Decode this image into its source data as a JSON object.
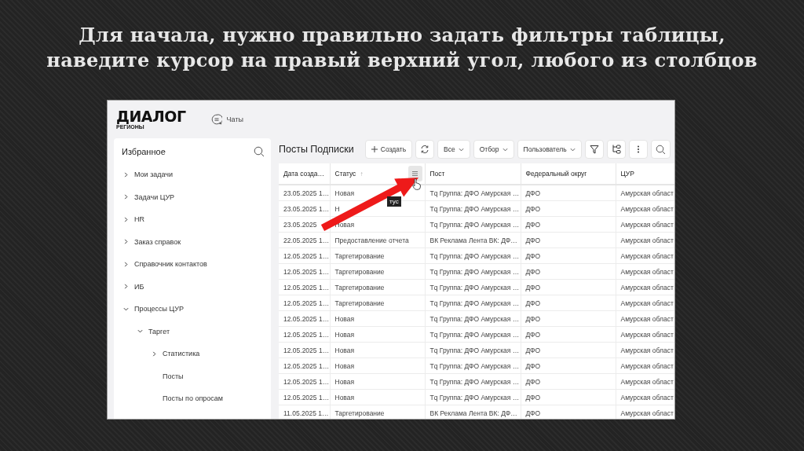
{
  "slide_title": [
    "Для начала, нужно правильно задать фильтры таблицы,",
    "наведите курсор на правый верхний угол, любого из столбцов"
  ],
  "app": {
    "logo": "ДИАЛОГ",
    "logo_sub": "РЕГИОНЫ",
    "top_link": "Чаты",
    "sidebar": {
      "title": "Избранное",
      "items": [
        {
          "label": "Мои задачи",
          "expanded": false
        },
        {
          "label": "Задачи ЦУР",
          "expanded": false
        },
        {
          "label": "HR",
          "expanded": false
        },
        {
          "label": "Заказ справок",
          "expanded": false
        },
        {
          "label": "Справочник контактов",
          "expanded": false
        },
        {
          "label": "ИБ",
          "expanded": false
        },
        {
          "label": "Процессы ЦУР",
          "expanded": true,
          "children": [
            {
              "label": "Таргет",
              "expanded": true,
              "children": [
                {
                  "label": "Статистика",
                  "expanded": false
                },
                {
                  "label": "Посты"
                },
                {
                  "label": "Посты по опросам"
                }
              ]
            }
          ]
        }
      ]
    },
    "page_title": "Посты Подписки",
    "toolbar": [
      {
        "kind": "create",
        "label": "Создать"
      },
      {
        "kind": "refresh"
      },
      {
        "kind": "dropdown",
        "label": "Все"
      },
      {
        "kind": "dropdown",
        "label": "Отбор"
      },
      {
        "kind": "dropdown",
        "label": "Пользователь"
      },
      {
        "kind": "filter"
      },
      {
        "kind": "tree"
      },
      {
        "kind": "more"
      },
      {
        "kind": "search"
      }
    ],
    "table": {
      "columns": [
        {
          "label": "Дата созда…"
        },
        {
          "label": "Статус",
          "sort_mark": "↑",
          "menu": true
        },
        {
          "label": "Пост"
        },
        {
          "label": "Федеральный округ"
        },
        {
          "label": "ЦУР"
        }
      ],
      "rows": [
        [
          "23.05.2025 1…",
          "Новая",
          "Tq Группа: ДФО Амурская …",
          "ДФО",
          "Амурская област"
        ],
        [
          "23.05.2025 1…",
          "Н",
          "Tq Группа: ДФО Амурская …",
          "ДФО",
          "Амурская област"
        ],
        [
          "23.05.2025",
          "Новая",
          "Tq Группа: ДФО Амурская …",
          "ДФО",
          "Амурская област"
        ],
        [
          "22.05.2025 1…",
          "Предоставление отчета",
          "ВК Реклама Лента ВК: ДФ…",
          "ДФО",
          "Амурская област"
        ],
        [
          "12.05.2025 1…",
          "Таргетирование",
          "Tq Группа: ДФО Амурская …",
          "ДФО",
          "Амурская област"
        ],
        [
          "12.05.2025 1…",
          "Таргетирование",
          "Tq Группа: ДФО Амурская …",
          "ДФО",
          "Амурская област"
        ],
        [
          "12.05.2025 1…",
          "Таргетирование",
          "Tq Группа: ДФО Амурская …",
          "ДФО",
          "Амурская област"
        ],
        [
          "12.05.2025 1…",
          "Таргетирование",
          "Tq Группа: ДФО Амурская …",
          "ДФО",
          "Амурская област"
        ],
        [
          "12.05.2025 1…",
          "Новая",
          "Tq Группа: ДФО Амурская …",
          "ДФО",
          "Амурская област"
        ],
        [
          "12.05.2025 1…",
          "Новая",
          "Tq Группа: ДФО Амурская …",
          "ДФО",
          "Амурская област"
        ],
        [
          "12.05.2025 1…",
          "Новая",
          "Tq Группа: ДФО Амурская …",
          "ДФО",
          "Амурская област"
        ],
        [
          "12.05.2025 1…",
          "Новая",
          "Tq Группа: ДФО Амурская …",
          "ДФО",
          "Амурская област"
        ],
        [
          "12.05.2025 1…",
          "Новая",
          "Tq Группа: ДФО Амурская …",
          "ДФО",
          "Амурская област"
        ],
        [
          "12.05.2025 1…",
          "Новая",
          "Tq Группа: ДФО Амурская …",
          "ДФО",
          "Амурская област"
        ],
        [
          "11.05.2025 1…",
          "Таргетирование",
          "ВК Реклама Лента ВК: ДФ…",
          "ДФО",
          "Амурская област"
        ]
      ]
    },
    "tooltip": "тус"
  }
}
